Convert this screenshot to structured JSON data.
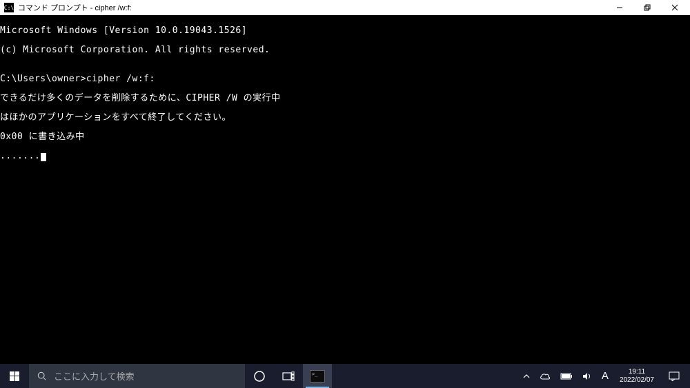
{
  "titlebar": {
    "icon_text": "C:\\",
    "title": "コマンド プロンプト - cipher  /w:f:"
  },
  "console": {
    "line1": "Microsoft Windows [Version 10.0.19043.1526]",
    "line2": "(c) Microsoft Corporation. All rights reserved.",
    "blank1": "",
    "prompt_line": "C:\\Users\\owner>cipher /w:f:",
    "msg1": "できるだけ多くのデータを削除するために、CIPHER /W の実行中",
    "msg2": "はほかのアプリケーションをすべて終了してください。",
    "msg3": "0x00 に書き込み中",
    "dots": "......."
  },
  "taskbar": {
    "search_placeholder": "ここに入力して検索",
    "ime_indicator": "A",
    "clock_time": "19:11",
    "clock_date": "2022/02/07"
  }
}
